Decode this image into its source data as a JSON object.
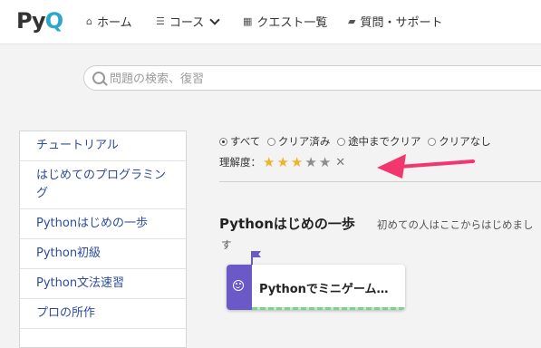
{
  "header": {
    "logo": {
      "p": "P",
      "y": "y",
      "q": "Q"
    },
    "nav": [
      {
        "icon": "home-icon",
        "glyph": "⌂",
        "label": "ホーム"
      },
      {
        "icon": "list-icon",
        "glyph": "☰",
        "label": "コース"
      },
      {
        "icon": "grid-icon",
        "glyph": "▦",
        "label": "クエスト一覧"
      },
      {
        "icon": "chat-icon",
        "glyph": "▰",
        "label": "質問・サポート"
      }
    ]
  },
  "search": {
    "placeholder": "問題の検索、復習"
  },
  "sidebar": {
    "items": [
      {
        "label": "チュートリアル"
      },
      {
        "label": "はじめてのプログラミング"
      },
      {
        "label": "Pythonはじめの一歩"
      },
      {
        "label": "Python初級"
      },
      {
        "label": "Python文法速習"
      },
      {
        "label": "プロの所作"
      }
    ]
  },
  "filters": {
    "options": [
      "すべて",
      "クリア済み",
      "途中までクリア",
      "クリアなし"
    ],
    "selected": "すべて"
  },
  "rating": {
    "label": "理解度：",
    "stars": 3,
    "max": 5,
    "clear_symbol": "✕"
  },
  "annotation": {
    "color": "#f2376e"
  },
  "section": {
    "title": "Pythonはじめの一歩",
    "desc_line1": "初めての人はここからはじめまし",
    "desc_line2": "す"
  },
  "card": {
    "title": "Pythonでミニゲーム…",
    "accent": "#6a59c6"
  },
  "colors": {
    "link": "#2d4b9a",
    "star": "#f0b429",
    "logo_q": "#2ea6cc"
  }
}
